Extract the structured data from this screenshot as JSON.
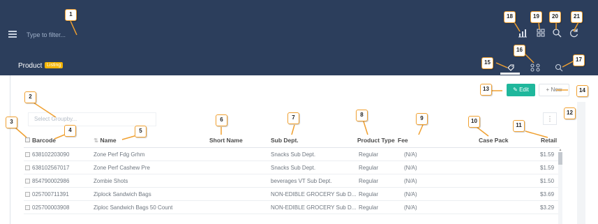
{
  "topbar": {
    "filter_placeholder": "Type to filter...",
    "icons": [
      "chart-icon",
      "grid-icon",
      "search-icon",
      "refresh-icon"
    ]
  },
  "page": {
    "title": "Product",
    "badge": "Listing"
  },
  "toolbar": {
    "edit_label": "Edit",
    "new_label": "+ New",
    "groupby_placeholder": "Select Groupby...",
    "kebab": "⋮"
  },
  "table": {
    "columns": {
      "barcode": "Barcode",
      "name": "Name",
      "short_name": "Short Name",
      "sub_dept": "Sub Dept.",
      "product_type": "Product Type",
      "fee": "Fee",
      "case_pack": "Case Pack",
      "retail": "Retail"
    },
    "rows": [
      {
        "barcode": "638102203090",
        "name": "Zone Perf Fdg Grhm",
        "sub_dept": "Snacks Sub Dept.",
        "product_type": "Regular",
        "fee": "(N/A)",
        "retail": "$1.59"
      },
      {
        "barcode": "638102567017",
        "name": "Zone Perf Cashew Pre",
        "sub_dept": "Snacks Sub Dept.",
        "product_type": "Regular",
        "fee": "(N/A)",
        "retail": "$1.59"
      },
      {
        "barcode": "854790002986",
        "name": "Zombie Shots",
        "sub_dept": "beverages VT Sub Dept.",
        "product_type": "Regular",
        "fee": "(N/A)",
        "retail": "$1.50"
      },
      {
        "barcode": "025700711391",
        "name": "Ziplock Sandwich Bags",
        "sub_dept": "NON-EDIBLE GROCERY Sub D...",
        "product_type": "Regular",
        "fee": "(N/A)",
        "retail": "$3.69"
      },
      {
        "barcode": "025700003908",
        "name": "Ziploc Sandwich Bags 50 Count",
        "sub_dept": "NON-EDIBLE GROCERY Sub D...",
        "product_type": "Regular",
        "fee": "(N/A)",
        "retail": "$3.29"
      }
    ]
  },
  "callouts": [
    "1",
    "2",
    "3",
    "4",
    "5",
    "6",
    "7",
    "8",
    "9",
    "10",
    "11",
    "12",
    "13",
    "14",
    "15",
    "16",
    "17",
    "18",
    "19",
    "20",
    "21"
  ],
  "colors": {
    "header_bg": "#2c3e5c",
    "edit_button": "#1fb79c",
    "badge": "#f5b400",
    "callout_border": "#f0a030"
  }
}
